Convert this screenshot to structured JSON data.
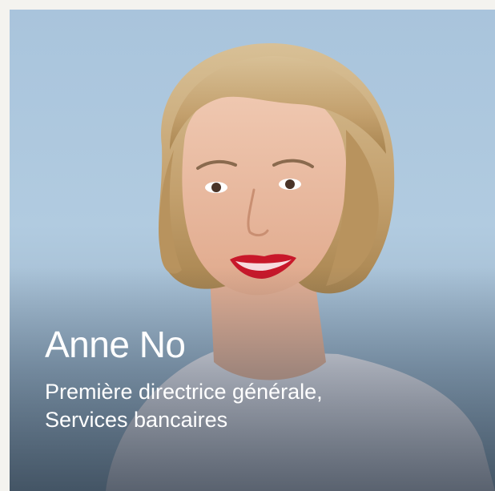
{
  "profile": {
    "name": "Anne No",
    "title_line1": "Première directrice générale,",
    "title_line2": "Services bancaires"
  },
  "colors": {
    "background": "#f4f3ef",
    "card_bg": "#a9c4dc",
    "text": "#ffffff",
    "lips": "#c8182a",
    "hair": "#c9a978"
  }
}
